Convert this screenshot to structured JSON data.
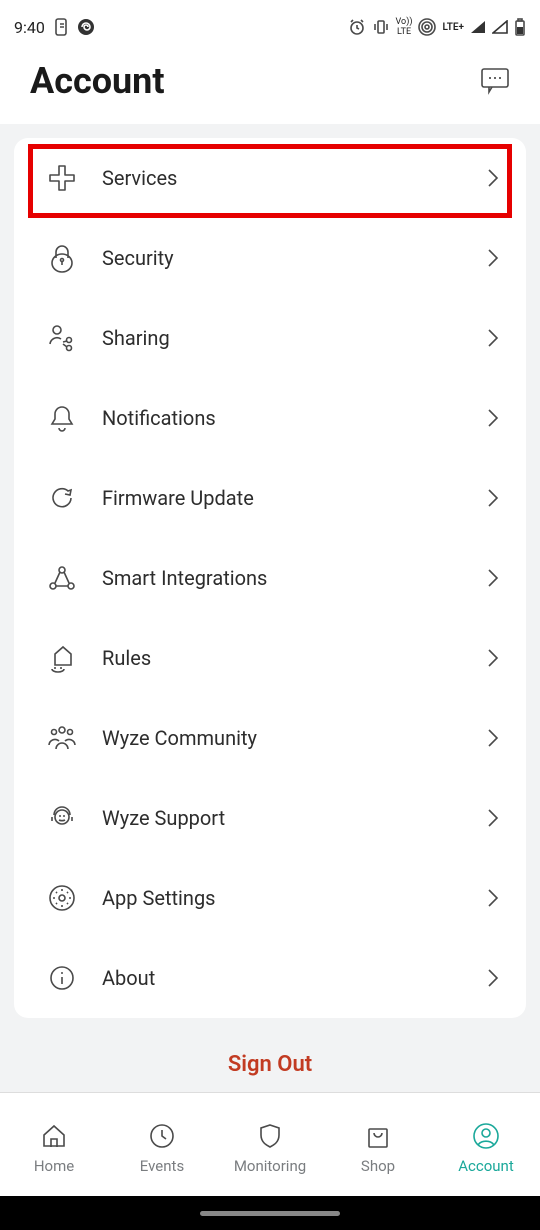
{
  "status": {
    "time": "9:40",
    "lte_label": "LTE+",
    "vo_label": "Vo))\nLTE"
  },
  "header": {
    "title": "Account"
  },
  "menu": [
    {
      "label": "Services",
      "icon": "plus-medical-icon",
      "highlighted": true
    },
    {
      "label": "Security",
      "icon": "lock-icon"
    },
    {
      "label": "Sharing",
      "icon": "share-people-icon"
    },
    {
      "label": "Notifications",
      "icon": "bell-icon"
    },
    {
      "label": "Firmware Update",
      "icon": "refresh-icon"
    },
    {
      "label": "Smart Integrations",
      "icon": "integration-nodes-icon"
    },
    {
      "label": "Rules",
      "icon": "rules-house-icon"
    },
    {
      "label": "Wyze Community",
      "icon": "community-people-icon"
    },
    {
      "label": "Wyze Support",
      "icon": "support-headset-icon"
    },
    {
      "label": "App Settings",
      "icon": "gear-icon"
    },
    {
      "label": "About",
      "icon": "info-icon"
    }
  ],
  "signout_label": "Sign Out",
  "nav": [
    {
      "label": "Home",
      "icon": "home-icon",
      "active": false
    },
    {
      "label": "Events",
      "icon": "clock-icon",
      "active": false
    },
    {
      "label": "Monitoring",
      "icon": "shield-icon",
      "active": false
    },
    {
      "label": "Shop",
      "icon": "bag-icon",
      "active": false
    },
    {
      "label": "Account",
      "icon": "person-circle-icon",
      "active": true
    }
  ],
  "colors": {
    "highlight_border": "#e60000",
    "active_teal": "#1aa89a",
    "signout_red": "#c23b22"
  }
}
